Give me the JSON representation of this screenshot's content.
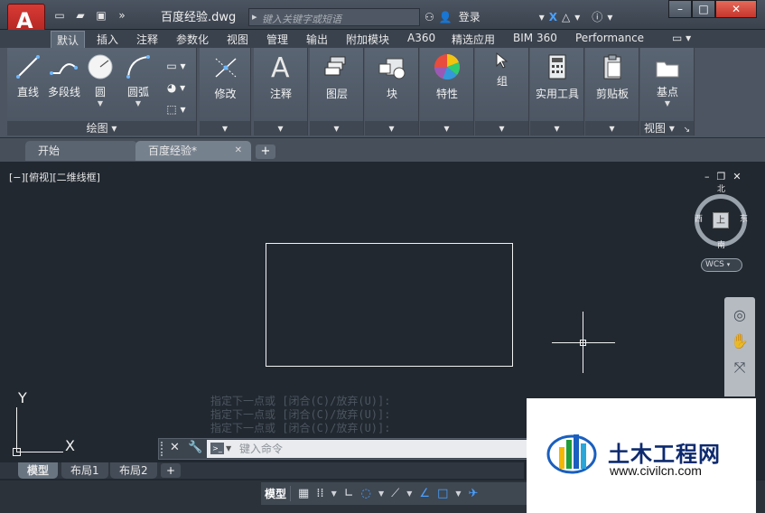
{
  "titlebar": {
    "doc_title": "百度经验.dwg",
    "search_placeholder": "键入关键字或短语",
    "login": "登录",
    "app_logo": "A"
  },
  "ribbon_tabs": [
    "默认",
    "插入",
    "注释",
    "参数化",
    "视图",
    "管理",
    "输出",
    "附加模块",
    "A360",
    "精选应用",
    "BIM 360",
    "Performance"
  ],
  "ribbon": {
    "draw_tools": [
      "直线",
      "多段线",
      "圆",
      "圆弧"
    ],
    "draw_panel": "绘图",
    "modify": "修改",
    "annotate": "注释",
    "layers": "图层",
    "block": "块",
    "properties": "特性",
    "group": "组",
    "utilities": "实用工具",
    "clipboard": "剪贴板",
    "base": "基点",
    "view_panel": "视图"
  },
  "doc_tabs": {
    "start": "开始",
    "active": "百度经验*"
  },
  "canvas": {
    "view_label": "[−][俯视][二维线框]",
    "compass": {
      "n": "北",
      "s": "南",
      "e": "东",
      "w": "西",
      "center": "上"
    },
    "wcs": "WCS",
    "ucs_x": "X",
    "ucs_y": "Y"
  },
  "command": {
    "history": [
      "指定下一点或 [闭合(C)/放弃(U)]:",
      "指定下一点或 [闭合(C)/放弃(U)]:",
      "指定下一点或 [闭合(C)/放弃(U)]:"
    ],
    "placeholder": "键入命令"
  },
  "layout_tabs": [
    "模型",
    "布局1",
    "布局2"
  ],
  "status": {
    "model": "模型"
  },
  "watermark": {
    "title": "土木工程网",
    "url": "www.civilcn.com"
  }
}
